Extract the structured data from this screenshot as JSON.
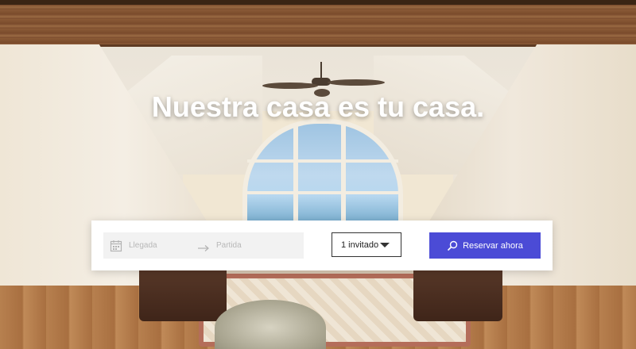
{
  "hero": {
    "headline": "Nuestra casa es tu casa."
  },
  "booking": {
    "checkin_placeholder": "Llegada",
    "checkout_placeholder": "Partida",
    "guests_value": "1 invitado",
    "reserve_label": "Reservar ahora"
  },
  "icons": {
    "calendar": "calendar-icon",
    "arrow": "arrow-right-icon",
    "dropdown": "caret-down-icon",
    "search": "search-icon"
  },
  "colors": {
    "accent": "#4b4bd6",
    "date_bg": "#f2f2f2",
    "headline": "#ffffff"
  }
}
